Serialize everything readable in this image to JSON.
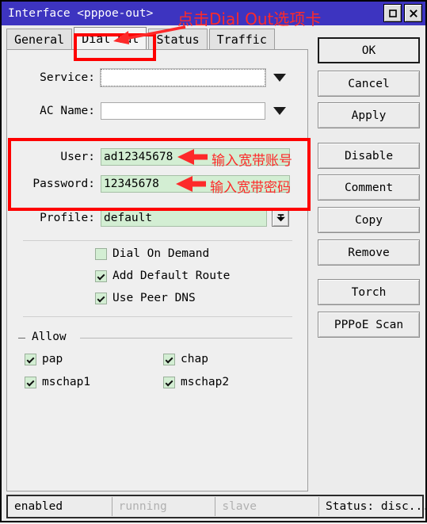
{
  "window": {
    "title": "Interface <pppoe-out>",
    "titlebar_color": "#3d34c0",
    "maximize_icon": "maximize-icon",
    "close_icon": "close-icon"
  },
  "tabs": [
    {
      "label": "General",
      "active": false
    },
    {
      "label": "Dial Out",
      "active": true
    },
    {
      "label": "Status",
      "active": false
    },
    {
      "label": "Traffic",
      "active": false
    }
  ],
  "form": {
    "service": {
      "label": "Service:",
      "value": "",
      "placeholder": ""
    },
    "ac_name": {
      "label": "AC Name:",
      "value": "",
      "placeholder": ""
    },
    "user": {
      "label": "User:",
      "value": "ad12345678"
    },
    "password": {
      "label": "Password:",
      "value": "12345678"
    },
    "profile": {
      "label": "Profile:",
      "value": "default"
    }
  },
  "options": [
    {
      "label": "Dial On Demand",
      "checked": false
    },
    {
      "label": "Add Default Route",
      "checked": true
    },
    {
      "label": "Use Peer DNS",
      "checked": true
    }
  ],
  "allow_group": {
    "title": "Allow",
    "items": [
      {
        "label": "pap",
        "checked": true
      },
      {
        "label": "chap",
        "checked": true
      },
      {
        "label": "mschap1",
        "checked": true
      },
      {
        "label": "mschap2",
        "checked": true
      }
    ]
  },
  "buttons": [
    {
      "label": "OK",
      "default": true
    },
    {
      "label": "Cancel",
      "default": false
    },
    {
      "label": "Apply",
      "default": false
    },
    {
      "label": "Disable",
      "default": false
    },
    {
      "label": "Comment",
      "default": false
    },
    {
      "label": "Copy",
      "default": false
    },
    {
      "label": "Remove",
      "default": false
    },
    {
      "label": "Torch",
      "default": false
    },
    {
      "label": "PPPoE Scan",
      "default": false
    }
  ],
  "statusbar": {
    "enabled": "enabled",
    "running": "running",
    "slave": "slave",
    "status": "Status: disc..."
  },
  "annotations": {
    "color": "#fd2a2a",
    "tab_note": "点击Dial Out选项卡",
    "user_note": "输入宽带账号",
    "password_note": "输入宽带密码"
  }
}
